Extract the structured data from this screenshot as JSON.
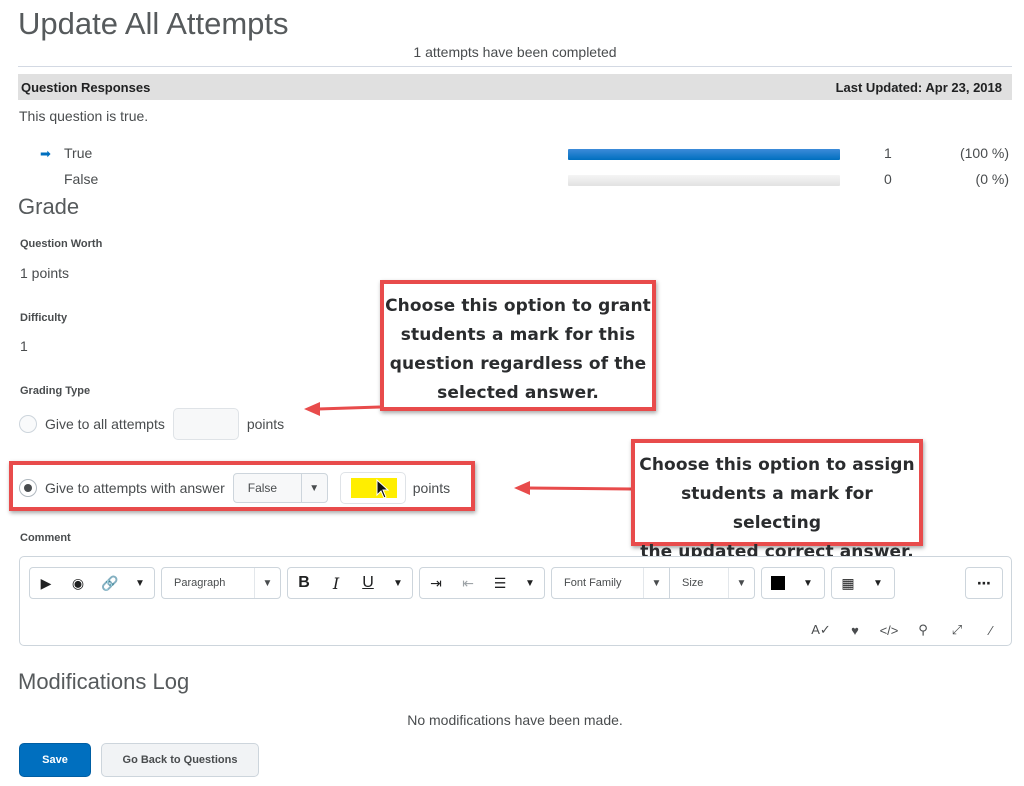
{
  "page": {
    "title": "Update All Attempts",
    "completed_text": "1 attempts have been completed"
  },
  "responses": {
    "header_label": "Question Responses",
    "last_updated": "Last Updated: Apr 23, 2018",
    "question_text": "This question is true.",
    "rows": [
      {
        "label": "True",
        "count": "1",
        "percent": "(100 %)",
        "fraction": 1.0,
        "is_correct": true
      },
      {
        "label": "False",
        "count": "0",
        "percent": "(0 %)",
        "fraction": 0.0,
        "is_correct": false
      }
    ]
  },
  "grade": {
    "section_title": "Grade",
    "worth_label": "Question Worth",
    "worth_value": "1 points",
    "difficulty_label": "Difficulty",
    "difficulty_value": "1",
    "grading_type_label": "Grading Type",
    "option_all_label": "Give to all attempts",
    "option_all_points": "",
    "option_answer_label": "Give to attempts with answer",
    "answer_select_value": "False",
    "option_answer_points": "",
    "points_suffix": "points",
    "selected_option": "answer"
  },
  "callouts": {
    "grant": "Choose this option to grant students a mark for this question regardless of the selected answer.",
    "grant_lines": [
      "Choose this option to grant",
      "students a mark for this",
      "question regardless of the",
      "selected answer."
    ],
    "assign_lines": [
      "Choose this option to assign",
      "students a mark for selecting",
      "the updated correct answer."
    ]
  },
  "comment": {
    "label": "Comment",
    "format_select": "Paragraph",
    "font_family_select": "Font Family",
    "size_select": "Size",
    "text_color": "#000000"
  },
  "log": {
    "section_title": "Modifications Log",
    "empty_text": "No modifications have been made."
  },
  "actions": {
    "save_label": "Save",
    "back_label": "Go Back to Questions"
  },
  "colors": {
    "accent": "#006fbf",
    "callout_border": "#e84b4b",
    "highlight": "#ffee00"
  }
}
